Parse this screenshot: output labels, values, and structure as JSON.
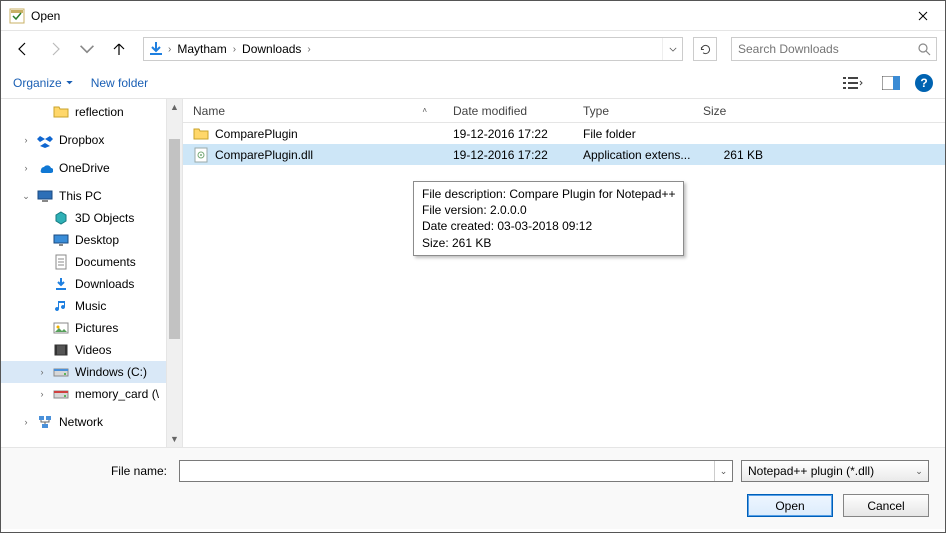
{
  "window": {
    "title": "Open"
  },
  "nav": {
    "breadcrumb": [
      "Maytham",
      "Downloads"
    ],
    "search_placeholder": "Search Downloads"
  },
  "toolbar": {
    "organize": "Organize",
    "new_folder": "New folder"
  },
  "tree": {
    "items": [
      {
        "label": "reflection",
        "icon": "folder",
        "level": 2,
        "expander": ""
      },
      {
        "spacer": true
      },
      {
        "label": "Dropbox",
        "icon": "dropbox",
        "level": 1,
        "expander": ">"
      },
      {
        "spacer": true
      },
      {
        "label": "OneDrive",
        "icon": "onedrive",
        "level": 1,
        "expander": ">"
      },
      {
        "spacer": true
      },
      {
        "label": "This PC",
        "icon": "thispc",
        "level": 1,
        "expander": "v"
      },
      {
        "label": "3D Objects",
        "icon": "3d",
        "level": 2,
        "expander": ""
      },
      {
        "label": "Desktop",
        "icon": "desktop",
        "level": 2,
        "expander": ""
      },
      {
        "label": "Documents",
        "icon": "documents",
        "level": 2,
        "expander": ""
      },
      {
        "label": "Downloads",
        "icon": "downloads",
        "level": 2,
        "expander": ""
      },
      {
        "label": "Music",
        "icon": "music",
        "level": 2,
        "expander": ""
      },
      {
        "label": "Pictures",
        "icon": "pictures",
        "level": 2,
        "expander": ""
      },
      {
        "label": "Videos",
        "icon": "videos",
        "level": 2,
        "expander": ""
      },
      {
        "label": "Windows (C:)",
        "icon": "drive",
        "level": 2,
        "expander": ">",
        "selected": true
      },
      {
        "label": "memory_card (\\",
        "icon": "netdrive",
        "level": 2,
        "expander": ">"
      },
      {
        "spacer": true
      },
      {
        "label": "Network",
        "icon": "network",
        "level": 1,
        "expander": ">"
      }
    ]
  },
  "columns": {
    "name": "Name",
    "date": "Date modified",
    "type": "Type",
    "size": "Size"
  },
  "files": [
    {
      "name": "ComparePlugin",
      "date": "19-12-2016 17:22",
      "type": "File folder",
      "size": "",
      "icon": "folder",
      "selected": false
    },
    {
      "name": "ComparePlugin.dll",
      "date": "19-12-2016 17:22",
      "type": "Application extens...",
      "size": "261 KB",
      "icon": "dll",
      "selected": true
    }
  ],
  "tooltip": {
    "line1": "File description: Compare Plugin for Notepad++",
    "line2": "File version: 2.0.0.0",
    "line3": "Date created: 03-03-2018 09:12",
    "line4": "Size: 261 KB"
  },
  "bottom": {
    "filename_label": "File name:",
    "filename_value": "",
    "filter": "Notepad++ plugin (*.dll)",
    "open": "Open",
    "cancel": "Cancel"
  }
}
